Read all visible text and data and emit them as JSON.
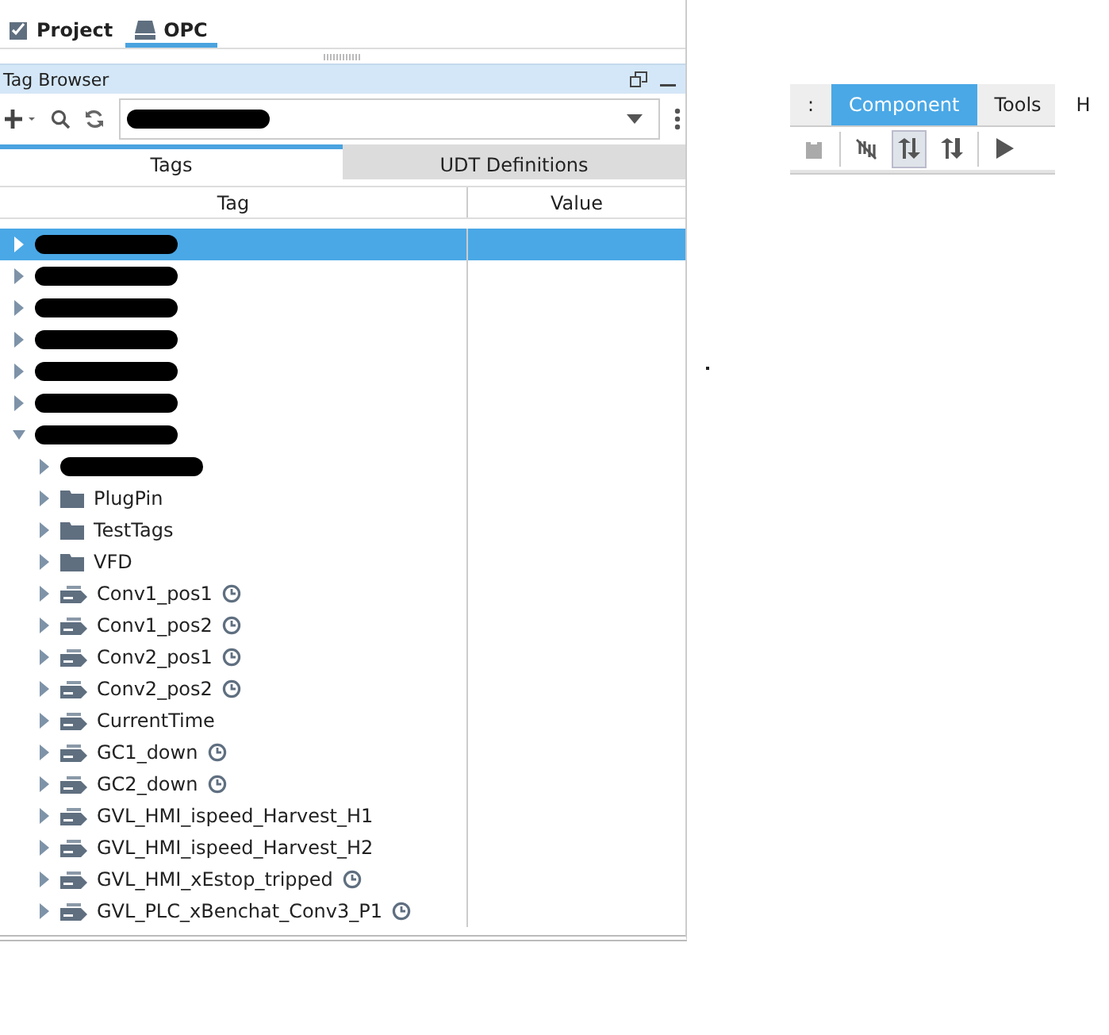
{
  "top_tabs": [
    {
      "label": "Project",
      "selected": false
    },
    {
      "label": "OPC",
      "selected": true
    }
  ],
  "panel": {
    "title": "Tag Browser"
  },
  "inner_tabs": [
    {
      "label": "Tags",
      "selected": true
    },
    {
      "label": "UDT Definitions",
      "selected": false
    }
  ],
  "table": {
    "columns": [
      "Tag",
      "Value"
    ],
    "rows": [
      {
        "kind": "redacted",
        "selected": true,
        "expanded": false
      },
      {
        "kind": "redacted",
        "selected": false,
        "expanded": false
      },
      {
        "kind": "redacted",
        "selected": false,
        "expanded": false
      },
      {
        "kind": "redacted",
        "selected": false,
        "expanded": false
      },
      {
        "kind": "redacted",
        "selected": false,
        "expanded": false
      },
      {
        "kind": "redacted",
        "selected": false,
        "expanded": false
      },
      {
        "kind": "redacted",
        "selected": false,
        "expanded": true,
        "children": [
          {
            "kind": "redacted",
            "selected": false,
            "expanded": false
          },
          {
            "kind": "folder",
            "name": "PlugPin",
            "selected": false,
            "expanded": false,
            "history": false
          },
          {
            "kind": "folder",
            "name": "TestTags",
            "selected": false,
            "expanded": false,
            "history": false
          },
          {
            "kind": "folder",
            "name": "VFD",
            "selected": false,
            "expanded": false,
            "history": false
          },
          {
            "kind": "tag",
            "name": "Conv1_pos1",
            "selected": false,
            "expanded": false,
            "history": true
          },
          {
            "kind": "tag",
            "name": "Conv1_pos2",
            "selected": false,
            "expanded": false,
            "history": true
          },
          {
            "kind": "tag",
            "name": "Conv2_pos1",
            "selected": false,
            "expanded": false,
            "history": true
          },
          {
            "kind": "tag",
            "name": "Conv2_pos2",
            "selected": false,
            "expanded": false,
            "history": true
          },
          {
            "kind": "tag",
            "name": "CurrentTime",
            "selected": false,
            "expanded": false,
            "history": false
          },
          {
            "kind": "tag",
            "name": "GC1_down",
            "selected": false,
            "expanded": false,
            "history": true
          },
          {
            "kind": "tag",
            "name": "GC2_down",
            "selected": false,
            "expanded": false,
            "history": true
          },
          {
            "kind": "tag",
            "name": "GVL_HMI_ispeed_Harvest_H1",
            "selected": false,
            "expanded": false,
            "history": false
          },
          {
            "kind": "tag",
            "name": "GVL_HMI_ispeed_Harvest_H2",
            "selected": false,
            "expanded": false,
            "history": false
          },
          {
            "kind": "tag",
            "name": "GVL_HMI_xEstop_tripped",
            "selected": false,
            "expanded": false,
            "history": true
          },
          {
            "kind": "tag",
            "name": "GVL_PLC_xBenchat_Conv3_P1",
            "selected": false,
            "expanded": false,
            "history": true
          }
        ]
      }
    ]
  },
  "menu": [
    {
      "label": ":",
      "selected": false
    },
    {
      "label": "Component",
      "selected": true
    },
    {
      "label": "Tools",
      "selected": false
    },
    {
      "label": "H",
      "selected": false
    }
  ],
  "toolbar": [
    {
      "kind": "clipboard",
      "disabled": true,
      "pressed": false
    },
    {
      "kind": "separator"
    },
    {
      "kind": "unlink",
      "disabled": false,
      "pressed": false
    },
    {
      "kind": "order-up",
      "disabled": false,
      "pressed": true
    },
    {
      "kind": "order-down",
      "disabled": false,
      "pressed": false
    },
    {
      "kind": "separator"
    },
    {
      "kind": "play",
      "disabled": false,
      "pressed": false
    }
  ]
}
